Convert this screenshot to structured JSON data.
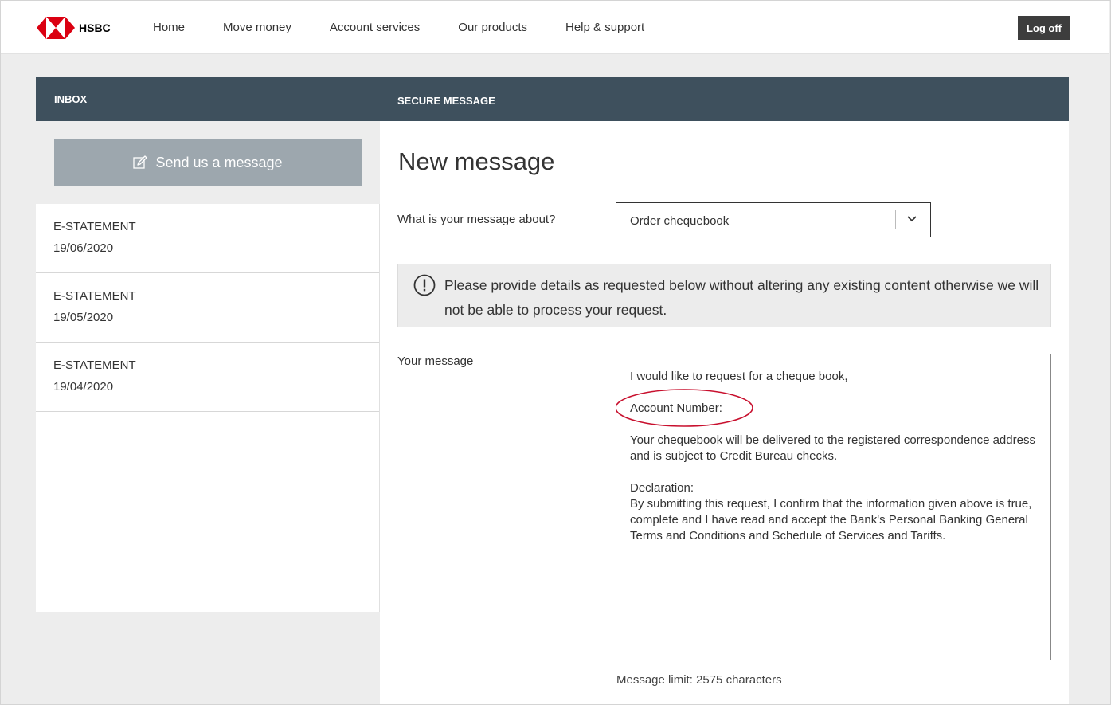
{
  "header": {
    "brand": "HSBC",
    "nav": [
      "Home",
      "Move money",
      "Account services",
      "Our products",
      "Help & support"
    ],
    "logoff_label": "Log off"
  },
  "band": {
    "left_title": "INBOX",
    "right_title": "SECURE MESSAGE"
  },
  "inbox": {
    "send_label": "Send us a message",
    "items": [
      {
        "type": "E-STATEMENT",
        "date": "19/06/2020"
      },
      {
        "type": "E-STATEMENT",
        "date": "19/05/2020"
      },
      {
        "type": "E-STATEMENT",
        "date": "19/04/2020"
      }
    ]
  },
  "compose": {
    "title": "New message",
    "topic_label": "What is your message about?",
    "topic_value": "Order chequebook",
    "notice": "Please provide details as requested below without altering any existing content otherwise we will not be able to process your request.",
    "message_label": "Your message",
    "message_text": "I would like to request for a cheque book,\n\nAccount Number:\n\nYour chequebook will be delivered to the registered correspondence address and is subject to Credit Bureau checks.\n\nDeclaration:\nBy submitting this request, I confirm that the information given above is true, complete and I have read and accept the Bank's Personal Banking General Terms and Conditions and Schedule of Services and Tariffs.",
    "limit_text": "Message limit: 2575 characters"
  },
  "colors": {
    "band": "#3e505d",
    "brand_red": "#db0011",
    "send_button": "#9da7ae",
    "annotation": "#c8102e"
  }
}
